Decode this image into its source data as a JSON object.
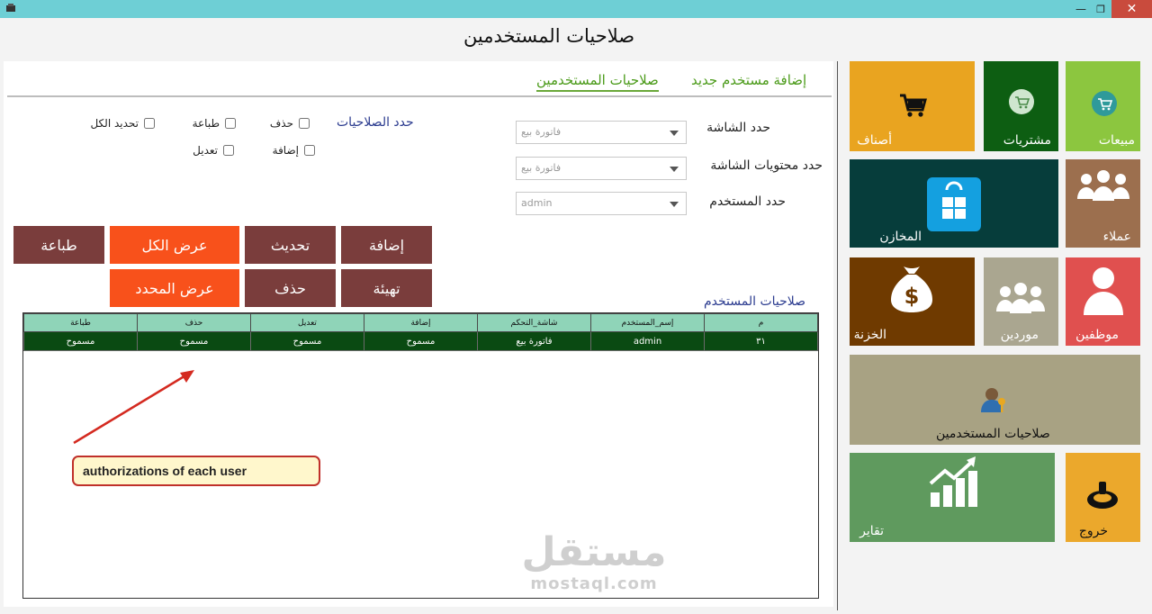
{
  "window": {
    "title": "صلاحيات المستخدمين",
    "minimize": "—",
    "maximize": "❐",
    "close": "✕"
  },
  "tabs": [
    {
      "label": "إضافة مستخدم جديد"
    },
    {
      "label": "صلاحيات المستخدمين"
    }
  ],
  "filters": {
    "screen_label": "حدد الشاشة",
    "screen_value": "فاتورة بيع",
    "content_label": "حدد محتويات الشاشة",
    "content_value": "فاتورة بيع",
    "user_label": "حدد المستخدم",
    "user_value": "admin"
  },
  "permissions": {
    "title": "حدد الصلاحيات",
    "delete": "حذف",
    "print": "طباعة",
    "select_all": "تحديد الكل",
    "add": "إضافة",
    "edit": "تعديل"
  },
  "buttons": {
    "add": "إضافة",
    "refresh": "تحديث",
    "show_all": "عرض الكل",
    "print": "طباعة",
    "reset": "تهيئة",
    "delete": "حذف",
    "show_selected": "عرض المحدد"
  },
  "grid": {
    "label": "صلاحيات المستخدم",
    "columns": [
      "م",
      "إسم_المستخدم",
      "شاشة_التحكم",
      "إضافة",
      "تعديل",
      "حذف",
      "طباعة"
    ],
    "rows": [
      [
        "٣١",
        "admin",
        "فاتورة بيع",
        "مسموح",
        "مسموح",
        "مسموح",
        "مسموح"
      ]
    ]
  },
  "annotation": {
    "text": "authorizations of each user"
  },
  "watermark": {
    "arabic": "مستقل",
    "latin": "mostaql.com"
  },
  "tiles": {
    "sales": "مبيعات",
    "purchases": "مشتريات",
    "categories": "أصناف",
    "customers": "عملاء",
    "stores": "المخازن",
    "employees": "موظفين",
    "suppliers": "موردين",
    "treasury": "الخزنة",
    "user_permissions": "صلاحيات المستخدمين",
    "exit": "خروج",
    "reports": "تقاير"
  },
  "colors": {
    "titlebar": "#6ecfd5",
    "sales": "#8cc63f",
    "purchases": "#0d5e12",
    "categories": "#e9a420",
    "customers": "#9c6f4e",
    "stores": "#063d3b",
    "employees": "#e0504f",
    "suppliers": "#aaa690",
    "treasury": "#6f3a00",
    "user_permissions": "#a8a283",
    "exit": "#eba82c",
    "reports": "#5f9a5e",
    "button_brown": "#7a3d3c",
    "button_orange": "#f8511b",
    "grid_header": "#8fd4b8",
    "grid_row": "#0a4a12"
  }
}
